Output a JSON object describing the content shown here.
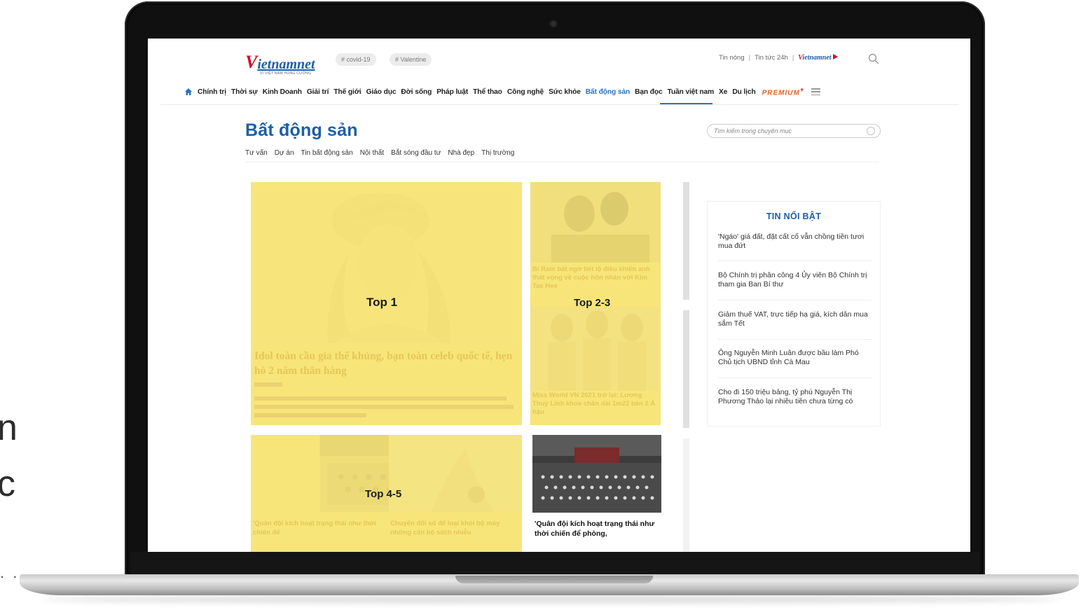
{
  "side_text": {
    "line1": "n",
    "line2": "c",
    "dots": ". ."
  },
  "site": {
    "logo_v": "V",
    "logo_text": "ietnamnet",
    "logo_sub": "VÌ VIỆT NAM HÙNG CƯỜNG",
    "tags": [
      "# covid-19",
      "# Valentine"
    ],
    "top_links": [
      "Tin nóng",
      "Tin tức 24h"
    ],
    "mini_logo_v": "V",
    "mini_logo_text": "ietnamnet"
  },
  "nav": {
    "items": [
      "Chính trị",
      "Thời sự",
      "Kinh Doanh",
      "Giải trí",
      "Thế giới",
      "Giáo dục",
      "Đời sống",
      "Pháp luật",
      "Thể thao",
      "Công nghệ",
      "Sức khỏe",
      "Bất động sản",
      "Bạn đọc",
      "Tuần việt nam",
      "Xe",
      "Du lịch"
    ],
    "active_index": 11,
    "premium": "PREMIUM",
    "premium_mark": "+"
  },
  "section": {
    "title": "Bất động sản",
    "sub_menu": [
      "Tư vấn",
      "Dự án",
      "Tin bất động sản",
      "Nội thất",
      "Bắt sóng đầu tư",
      "Nhà đẹp",
      "Thị trường"
    ],
    "search_placeholder": "Tìm kiếm trong chuyên mục"
  },
  "grid": {
    "top1": {
      "label": "Top 1",
      "headline": "Idol toàn cầu gia thế khủng, bạn toàn celeb quốc tế, hẹn hò 2 năm thân hàng"
    },
    "top23": {
      "label": "Top 2-3",
      "headline1": "Bi Rain bất ngờ tiết lộ điều khiến anh thất vọng về cuộc hôn nhân với Kim Tae Hee",
      "headline2": "Miss World VN 2021 trở lại: Lương Thuỳ Linh khoe chân dài 1m22 bên 2 Á hậu"
    },
    "top45": {
      "label": "Top 4-5",
      "headline1": "'Quân đội kích hoạt trạng thái như thời chiến để",
      "headline2": "Chuyển đổi số để loại khỏi bộ máy những cán bộ sách nhiễu"
    },
    "extra_headline": "'Quân đội kích hoạt trạng thái như thời chiến để phòng,"
  },
  "sidebar": {
    "title": "TIN NỔI BẬT",
    "items": [
      "'Ngáo' giá đất, đặt cất cố vẫn chồng tiền tươi mua đứt",
      "Bộ Chính trị phân công 4 Ủy viên Bộ Chính trị tham gia Ban Bí thư",
      "Giảm thuế VAT, trực tiếp hạ giá, kích dân mua sắm Tết",
      "Ông Nguyễn Minh Luân được bầu làm Phó Chủ tịch UBND tỉnh Cà Mau",
      "Cho đi 150 triệu bảng, tỷ phú Nguyễn Thị Phương Thảo lại nhiều tiền chưa từng có"
    ]
  }
}
